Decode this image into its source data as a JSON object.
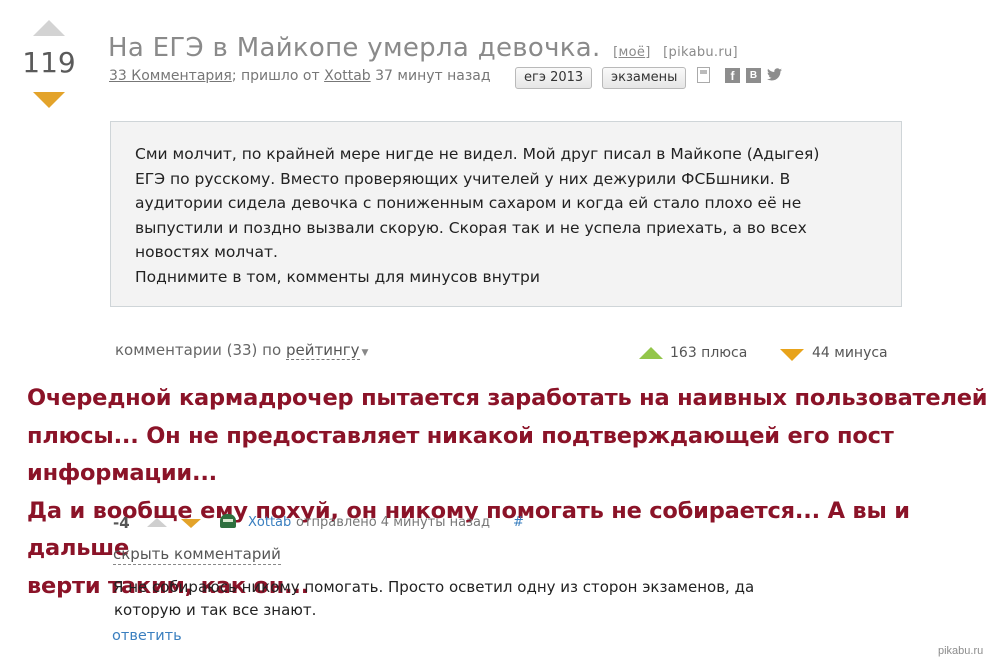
{
  "post": {
    "rating": "119",
    "title": "На ЕГЭ в Майкопе умерла девочка.",
    "tag_moe": "моё",
    "source": "[pikabu.ru]",
    "comments_link": "33 Комментария",
    "meta_mid": "; пришло от",
    "author": "Xottab",
    "time_ago": "37 минут назад",
    "tags": [
      "егэ 2013",
      "экзамены"
    ],
    "share": {
      "facebook": "f",
      "vk": "B",
      "twitter": "🐦"
    },
    "story_lines": [
      "Сми молчит, по крайней мере нигде не видел. Мой друг писал в Майкопе (Адыгея)",
      "ЕГЭ по русскому. Вместо проверяющих учителей у них дежурили ФСБшники. В",
      "аудитории сидела девочка с пониженным сахаром и когда ей стало плохо её не",
      "выпустили и поздно вызвали скорую. Скорая так и не успела приехать, а во всех",
      "новостях молчат.",
      "Поднимите в том, комменты для минусов внутри"
    ]
  },
  "comments_header": {
    "prefix": "комментарии (33) по",
    "sort_label": "рейтингу",
    "plus": "163 плюса",
    "minus": "44 минуса"
  },
  "overlay_lines": [
    "Очередной кармадрочер пытается заработать на наивных пользователей",
    "плюсы... Он не предоставляет никакой подтверждающей его пост информации...",
    "Да и вообще ему похуй, он никому помогать не собирается... А вы и дальше",
    "верти таким, как он..."
  ],
  "comment": {
    "rating": "-4",
    "author": "Xottab",
    "sent": "отправлено 4 минуты назад",
    "hash": "#",
    "hide": "скрыть комментарий",
    "text_lines": [
      "Я не собираюсь никому помогать. Просто осветил одну из сторон экзаменов, да",
      "которую и так все знают."
    ],
    "reply": "ответить"
  },
  "watermark": "pikabu.ru",
  "colors": {
    "overlay_text": "#8b1328",
    "link": "#3a7fbf",
    "plus": "#93c64a",
    "minus": "#e3a32a"
  }
}
